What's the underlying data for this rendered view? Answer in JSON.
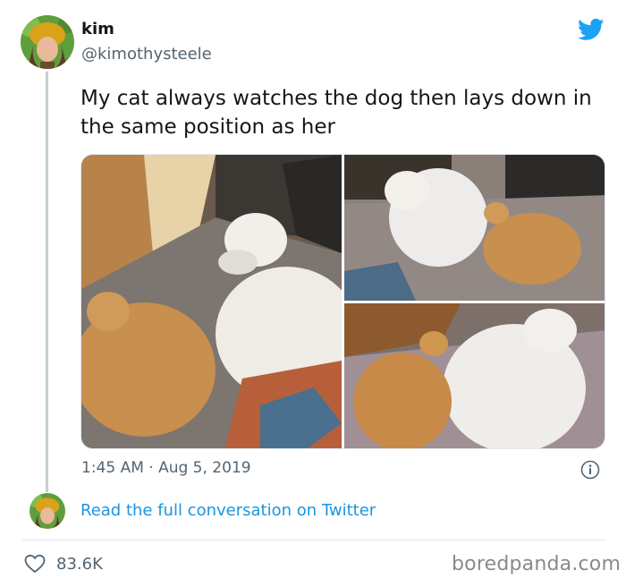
{
  "author": {
    "name": "kim",
    "handle": "@kimothysteele"
  },
  "tweet": {
    "text": "My cat always watches the dog then lays down in the same position as her",
    "timestamp": "1:45 AM · Aug 5, 2019"
  },
  "media": [
    {
      "alt": "cat-and-dog-photo-1"
    },
    {
      "alt": "cat-and-dog-photo-2"
    },
    {
      "alt": "cat-and-dog-photo-3"
    }
  ],
  "conversation_link": "Read the full conversation on Twitter",
  "likes": "83.6K",
  "watermark": "boredpanda.com",
  "colors": {
    "twitter_blue": "#1da1f2",
    "link_blue": "#1b95e0",
    "secondary_text": "#536471",
    "divider": "#e1e8ed"
  },
  "icons": [
    "twitter-bird-icon",
    "info-icon",
    "heart-icon"
  ]
}
